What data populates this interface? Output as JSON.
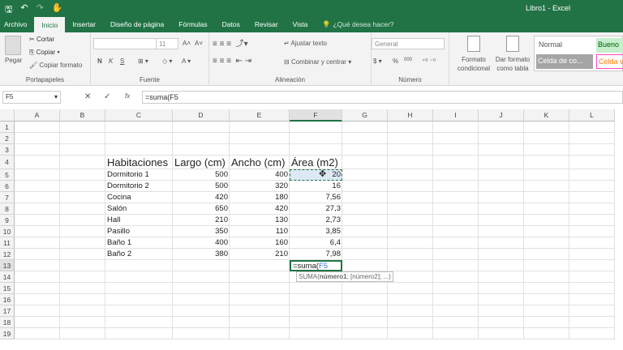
{
  "window": {
    "title": "Libro1 - Excel"
  },
  "qat": {
    "save": "🖫",
    "undo": "↶",
    "redo": "↷",
    "touch": "✋"
  },
  "tabs": [
    "Archivo",
    "Inicio",
    "Insertar",
    "Diseño de página",
    "Fórmulas",
    "Datos",
    "Revisar",
    "Vista"
  ],
  "tell_me": "¿Qué desea hacer?",
  "ribbon": {
    "clipboard": {
      "paste": "Pegar",
      "cut": "Cortar",
      "copy": "Copiar",
      "format_painter": "Copiar formato",
      "label": "Portapapeles"
    },
    "font": {
      "size": "11",
      "bold": "N",
      "italic": "K",
      "underline": "S",
      "label": "Fuente",
      "grow": "A˄",
      "shrink": "A˅"
    },
    "alignment": {
      "wrap": "Ajustar texto",
      "merge": "Combinar y centrar",
      "label": "Alineación"
    },
    "number": {
      "format": "General",
      "percent": "%",
      "thousands": "000",
      "label": "Número"
    },
    "styles": {
      "conditional": "Formato condicional",
      "as_table": "Dar formato como tabla",
      "normal": "Normal",
      "good": "Bueno",
      "check_cell": "Celda de co...",
      "linked_cell": "Celda v"
    }
  },
  "formula_bar": {
    "name_box": "F5",
    "cancel": "✕",
    "enter": "✓",
    "fx": "fx",
    "formula": "=suma(F5"
  },
  "columns": [
    "A",
    "B",
    "C",
    "D",
    "E",
    "F",
    "G",
    "H",
    "I",
    "J",
    "K",
    "L"
  ],
  "rows": [
    "1",
    "2",
    "3",
    "4",
    "5",
    "6",
    "7",
    "8",
    "9",
    "10",
    "11",
    "12",
    "13",
    "14",
    "15",
    "16",
    "17",
    "18",
    "19"
  ],
  "table": {
    "headers": [
      "Habitaciones",
      "Largo (cm)",
      "Ancho (cm)",
      "Área (m2)"
    ],
    "rows": [
      [
        "Dormitorio 1",
        "500",
        "400",
        "20"
      ],
      [
        "Dormitorio 2",
        "500",
        "320",
        "16"
      ],
      [
        "Cocina",
        "420",
        "180",
        "7,56"
      ],
      [
        "Salón",
        "650",
        "420",
        "27,3"
      ],
      [
        "Hall",
        "210",
        "130",
        "2,73"
      ],
      [
        "Pasillo",
        "350",
        "110",
        "3,85"
      ],
      [
        "Baño 1",
        "400",
        "160",
        "6,4"
      ],
      [
        "Baño 2",
        "380",
        "210",
        "7,98"
      ]
    ]
  },
  "editing": {
    "cell_prefix": "=suma(",
    "cell_ref": "F5",
    "tooltip_fn": "SUMA(",
    "tooltip_arg1": "número1",
    "tooltip_rest": "; [número2]; ...)"
  }
}
